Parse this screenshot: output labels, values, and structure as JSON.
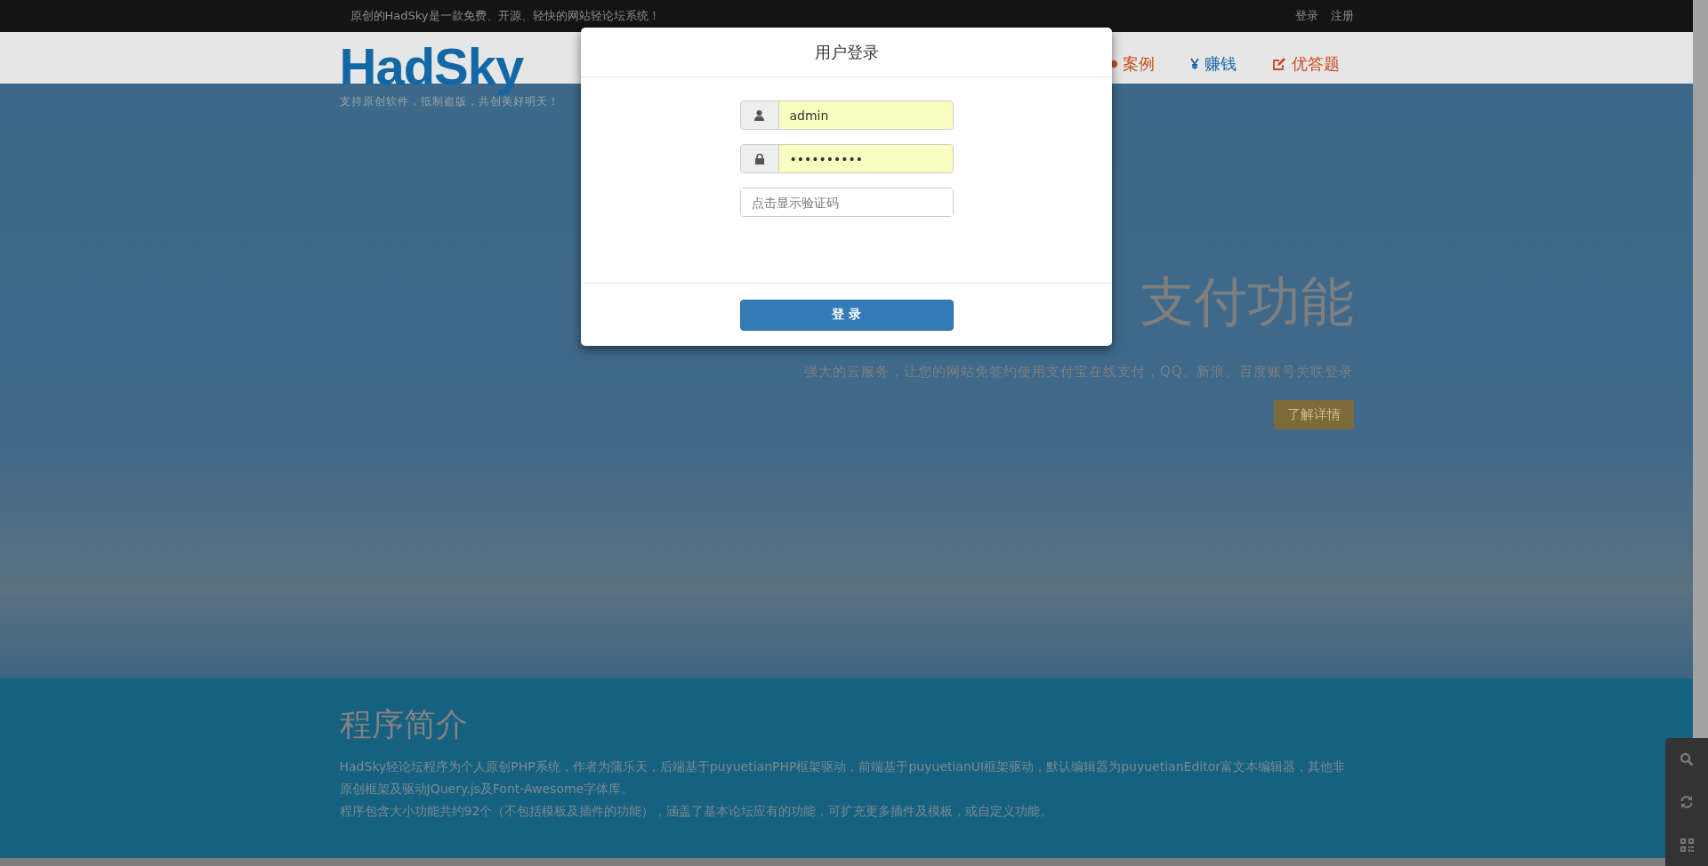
{
  "top_bar": {
    "tagline": "原创的HadSky是一款免费、开源、轻快的网站轻论坛系统！",
    "links": [
      "登录",
      "注册"
    ]
  },
  "header": {
    "logo": "HadSky",
    "slogan": "支持原创软件，抵制盗版，共创美好明天！",
    "nav": [
      {
        "label": "案例",
        "color": "#c9491e"
      },
      {
        "label": "赚钱",
        "color": "#1d65a3"
      },
      {
        "label": "优答题",
        "color": "#c9491e"
      }
    ]
  },
  "hero": {
    "title": "支付功能",
    "subtitle": "强大的云服务，让您的网站免签约使用支付宝在线支付，QQ、新浪、百度账号关联登录",
    "button": "了解详情"
  },
  "intro": {
    "title": "程序简介",
    "paragraphs": [
      "HadSky轻论坛程序为个人原创PHP系统，作者为蒲乐天，后端基于puyuetianPHP框架驱动，前端基于puyuetianUI框架驱动，默认编辑器为puyuetianEditor富文本编辑器，其他非原创框架及驱动JQuery.js及Font-Awesome字体库。",
      "程序包含大小功能共约92个（不包括模板及插件的功能），涵盖了基本论坛应有的功能，可扩充更多插件及模板，或自定义功能。"
    ]
  },
  "login_modal": {
    "title": "用户登录",
    "fields": [
      {
        "kind": "username",
        "value": "admin",
        "autofilled": true
      },
      {
        "kind": "password",
        "value": "••••••••••",
        "autofilled": true
      },
      {
        "kind": "captcha",
        "placeholder": "点击显示验证码",
        "autofilled": false
      }
    ],
    "button": "登 录"
  }
}
